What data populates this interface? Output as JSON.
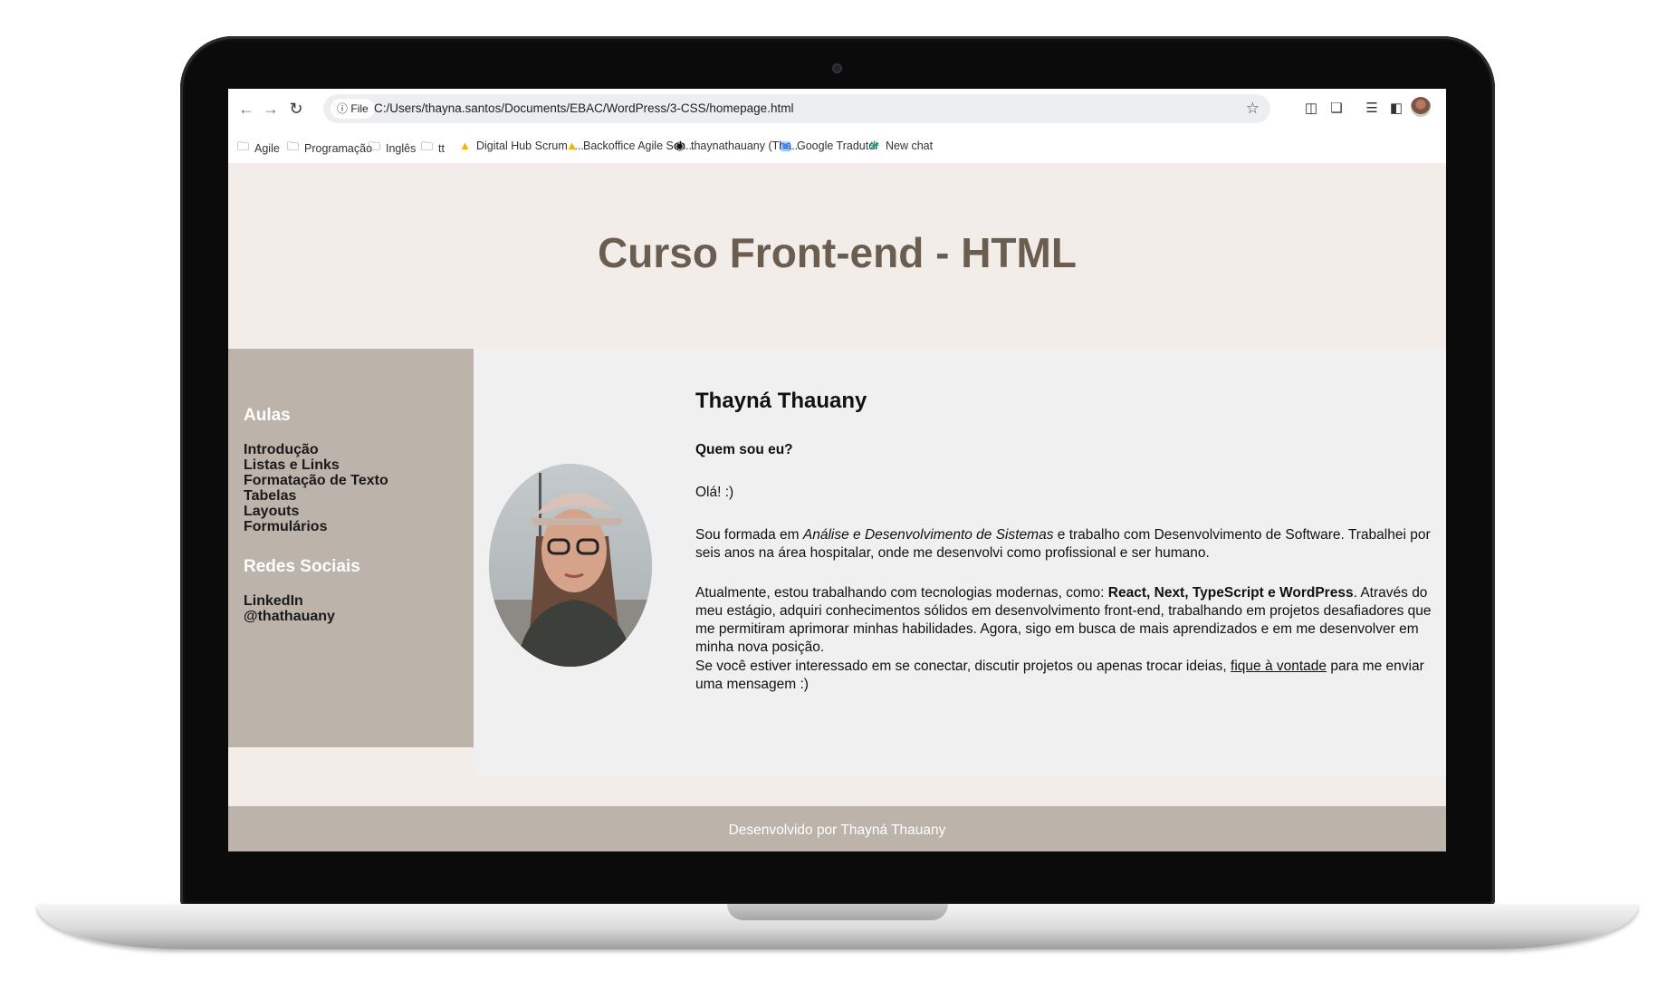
{
  "browser": {
    "file_chip": "File",
    "url": "C:/Users/thayna.santos/Documents/EBAC/WordPress/3-CSS/homepage.html",
    "icons": [
      "back-icon",
      "forward-icon",
      "reload-icon",
      "info-icon",
      "star-icon",
      "extension-icon",
      "puzzle-icon",
      "reading-list-icon",
      "side-panel-icon",
      "profile-avatar"
    ]
  },
  "bookmarks": [
    {
      "label": "Agile",
      "icon": "folder-icon"
    },
    {
      "label": "Programação",
      "icon": "folder-icon"
    },
    {
      "label": "Inglês",
      "icon": "folder-icon"
    },
    {
      "label": "tt",
      "icon": "folder-icon"
    },
    {
      "label": "Digital Hub Scrum -...",
      "icon": "drive-icon"
    },
    {
      "label": "Backoffice Agile Sch...",
      "icon": "drive-icon"
    },
    {
      "label": "thaynathauany (Tha...",
      "icon": "github-icon"
    },
    {
      "label": "Google Tradutor",
      "icon": "translate-icon"
    },
    {
      "label": "New chat",
      "icon": "chat-icon"
    }
  ],
  "page": {
    "title": "Curso Front-end - HTML",
    "sidebar": {
      "heading_aulas": "Aulas",
      "aulas": [
        "Introdução",
        "Listas e Links",
        "Formatação de Texto",
        "Tabelas",
        "Layouts",
        "Formulários"
      ],
      "heading_redes": "Redes Sociais",
      "redes": [
        "LinkedIn",
        "@thathauany"
      ]
    },
    "profile": {
      "name": "Thayná Thauany",
      "subtitle": "Quem sou eu?",
      "greeting": "Olá! :)",
      "p1_a": "Sou formada em ",
      "p1_em": "Análise e Desenvolvimento de Sistemas",
      "p1_b": " e trabalho com Desenvolvimento de Software. Trabalhei por seis anos na área hospitalar, onde me desenvolvi como profissional e ser humano.",
      "p2_a": "Atualmente, estou trabalhando com tecnologias modernas, como: ",
      "p2_strong": "React, Next, TypeScript e WordPress",
      "p2_b": ". Através do meu estágio, adquiri conhecimentos sólidos em desenvolvimento front-end, trabalhando em projetos desafiadores que me permitiram aprimorar minhas habilidades. Agora, sigo em busca de mais aprendizados e em me desenvolver em minha nova posição.",
      "p3_a": "Se você estiver interessado em se conectar, discutir projetos ou apenas trocar ideias, ",
      "p3_link": "fique à vontade",
      "p3_b": " para me enviar uma mensagem :)"
    },
    "footer": "Desenvolvido por Thayná Thauany"
  },
  "colors": {
    "page_bg": "#f2ede8",
    "sidebar_bg": "#bcb3ab",
    "title": "#6b5d50",
    "main_bg": "#f0f0f0"
  }
}
